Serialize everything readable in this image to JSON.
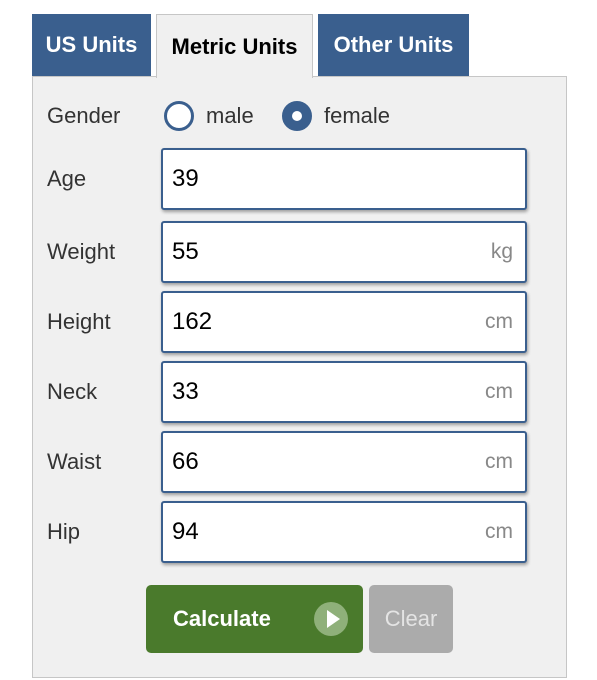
{
  "tabs": {
    "us": "US Units",
    "metric": "Metric Units",
    "other": "Other Units",
    "active": "metric"
  },
  "form": {
    "gender": {
      "label": "Gender",
      "options": [
        "male",
        "female"
      ],
      "selected": "female"
    },
    "age": {
      "label": "Age",
      "value": "39",
      "unit": ""
    },
    "weight": {
      "label": "Weight",
      "value": "55",
      "unit": "kg"
    },
    "height": {
      "label": "Height",
      "value": "162",
      "unit": "cm"
    },
    "neck": {
      "label": "Neck",
      "value": "33",
      "unit": "cm"
    },
    "waist": {
      "label": "Waist",
      "value": "66",
      "unit": "cm"
    },
    "hip": {
      "label": "Hip",
      "value": "94",
      "unit": "cm"
    }
  },
  "buttons": {
    "calculate": "Calculate",
    "clear": "Clear"
  },
  "colors": {
    "tab_blue": "#3a5f8e",
    "calculate_green": "#4a7a2c",
    "clear_gray": "#ababab",
    "panel_bg": "#f0f0f0"
  }
}
